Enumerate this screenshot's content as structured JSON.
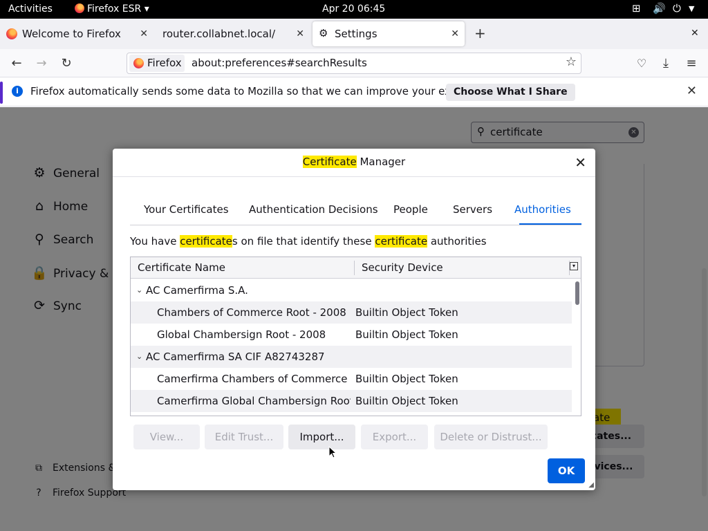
{
  "topbar": {
    "activities": "Activities",
    "app": "Firefox ESR",
    "app_arrow": "▾",
    "clock": "Apr 20  06:45"
  },
  "tabs": [
    {
      "label": "Welcome to Firefox"
    },
    {
      "label": "router.collabnet.local/"
    },
    {
      "label": "Settings"
    }
  ],
  "navbar": {
    "identity": "Firefox",
    "url": "about:preferences#searchResults"
  },
  "notification": {
    "message": "Firefox automatically sends some data to Mozilla so that we can improve your experience.",
    "button": "Choose What I Share"
  },
  "settings": {
    "search_value": "certificate",
    "sidebar": [
      {
        "label": "General"
      },
      {
        "label": "Home"
      },
      {
        "label": "Search"
      },
      {
        "label": "Privacy & S"
      },
      {
        "label": "Sync"
      }
    ],
    "sidebar_footer": [
      {
        "label": "Extensions &"
      },
      {
        "label": "Firefox Support"
      }
    ],
    "bg_highlight": "ate",
    "bg_buttons": [
      {
        "label": "icates..."
      },
      {
        "label": "evices..."
      }
    ]
  },
  "dialog": {
    "title_highlight": "Certificate",
    "title_rest": " Manager",
    "tabs": [
      {
        "label": "Your Certificates"
      },
      {
        "label": "Authentication Decisions"
      },
      {
        "label": "People"
      },
      {
        "label": "Servers"
      },
      {
        "label": "Authorities"
      }
    ],
    "desc": {
      "p1": "You have ",
      "h1": "certificate",
      "p2": "s on file that identify these ",
      "h2": "certificate",
      "p3": " authorities"
    },
    "columns": {
      "name": "Certificate Name",
      "device": "Security Device"
    },
    "rows": [
      {
        "name": "AC Camerfirma S.A.",
        "device": ""
      },
      {
        "name": "Chambers of Commerce Root - 2008",
        "device": "Builtin Object Token"
      },
      {
        "name": "Global Chambersign Root - 2008",
        "device": "Builtin Object Token"
      },
      {
        "name": "AC Camerfirma SA CIF A82743287",
        "device": ""
      },
      {
        "name": "Camerfirma Chambers of Commerce R...",
        "device": "Builtin Object Token"
      },
      {
        "name": "Camerfirma Global Chambersign Root",
        "device": "Builtin Object Token"
      }
    ],
    "buttons": {
      "view": "View...",
      "edit": "Edit Trust...",
      "import": "Import...",
      "export": "Export...",
      "delete": "Delete or Distrust...",
      "ok": "OK"
    }
  },
  "colors": {
    "accent": "#0060df",
    "highlight": "#ffe900",
    "notice_accent": "#592acb"
  }
}
